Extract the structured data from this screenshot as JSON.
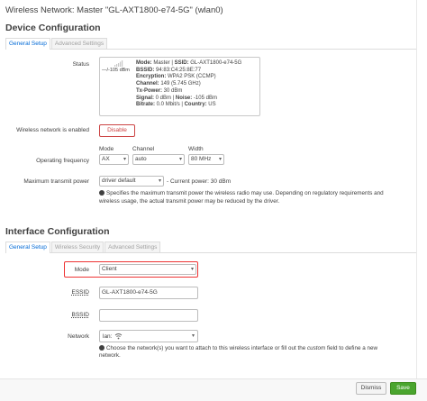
{
  "page": {
    "title": "Wireless Network: Master \"GL-AXT1800-e74-5G\" (wlan0)"
  },
  "device": {
    "section_title": "Device Configuration",
    "tabs": [
      {
        "label": "General Setup"
      },
      {
        "label": "Advanced Settings"
      }
    ],
    "status": {
      "label": "Status",
      "signal_text": "—/-105 dBm",
      "line1_key": "Mode:",
      "line1_val": " Master | ",
      "line1_key2": "SSID:",
      "line1_val2": " GL-AXT1800-e74-5G",
      "line2_key": "BSSID:",
      "line2_val": " 94:83:C4:25:8E:77",
      "line3_key": "Encryption:",
      "line3_val": " WPA2 PSK (CCMP)",
      "line4_key": "Channel:",
      "line4_val": " 149 (5.745 GHz)",
      "line5_key": "Tx-Power:",
      "line5_val": " 30 dBm",
      "line6_key": "Signal:",
      "line6_val": " 0 dBm | ",
      "line6_key2": "Noise:",
      "line6_val2": " -105 dBm",
      "line7_key": "Bitrate:",
      "line7_val": " 0.0 Mbit/s | ",
      "line7_key2": "Country:",
      "line7_val2": " US"
    },
    "enabled": {
      "label": "Wireless network is enabled",
      "button": "Disable"
    },
    "frequency": {
      "label": "Operating frequency",
      "mode_label": "Mode",
      "mode_value": "AX",
      "channel_label": "Channel",
      "channel_value": "auto",
      "width_label": "Width",
      "width_value": "80 MHz"
    },
    "txpower": {
      "label": "Maximum transmit power",
      "value": "driver default",
      "current": "- Current power: 30 dBm",
      "help_line1": "Specifies the maximum transmit power the wireless radio may use. Depending on regulatory requirements and",
      "help_line2": "wireless usage, the actual transmit power may be reduced by the driver."
    }
  },
  "iface": {
    "section_title": "Interface Configuration",
    "tabs": [
      {
        "label": "General Setup"
      },
      {
        "label": "Wireless Security"
      },
      {
        "label": "Advanced Settings"
      }
    ],
    "mode": {
      "label": "Mode",
      "value": "Client"
    },
    "essid": {
      "label": "ESSID",
      "value": "GL-AXT1800-e74-5G"
    },
    "bssid": {
      "label": "BSSID",
      "value": ""
    },
    "network": {
      "label": "Network",
      "value": "lan:",
      "help_pre": "Choose the network(s) you want to attach to this wireless interface or fill out the ",
      "help_em": "custom",
      "help_post": " field to define a new",
      "help_line2": "network."
    }
  },
  "footer": {
    "dismiss": "Dismiss",
    "save": "Save"
  },
  "colors": {
    "accent": "#0069d6",
    "danger": "#cc4444",
    "save": "#4aa52e"
  }
}
